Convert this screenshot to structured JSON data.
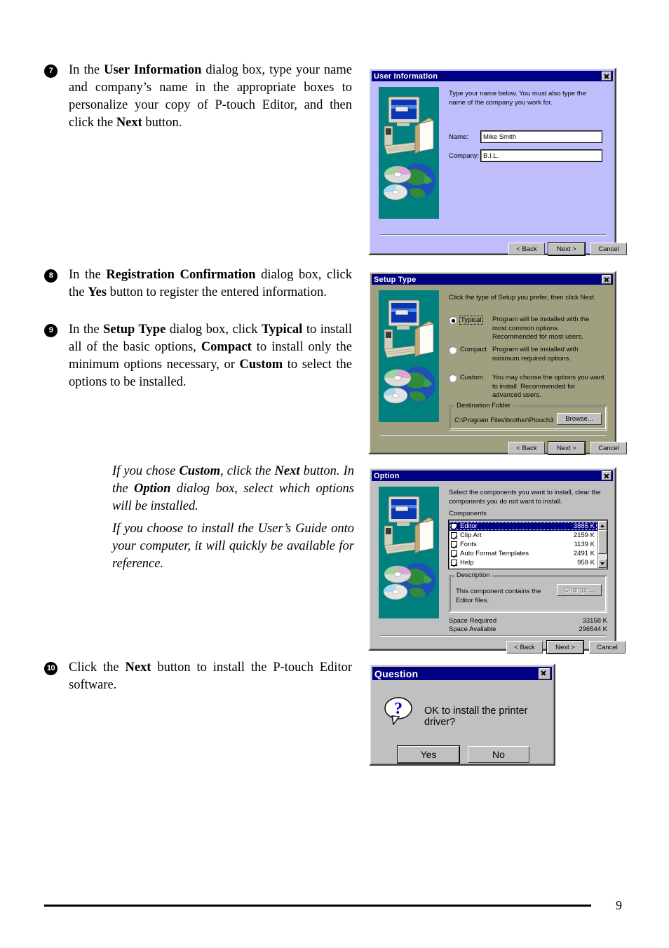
{
  "page": {
    "number": "9"
  },
  "steps": [
    {
      "marker": "7",
      "html": "In the <b>User Information</b> dialog box, type your name and company’s name in the appropriate boxes to personalize your copy of P-touch Editor, and then click the <b>Next</b> button."
    },
    {
      "marker": "8",
      "html": "In the <b>Registration Confirmation</b> dialog box, click the <b>Yes</b> button to register the entered information."
    },
    {
      "marker": "9",
      "html": "In the <b>Setup Type</b> dialog box, click <b>Typical</b> to install all of the basic options, <b>Compact</b> to install only the minimum options necessary, or <b>Custom</b> to select the options to be installed."
    },
    {
      "marker": "10",
      "html": "Click the <b>Next</b> button to install the P-touch Editor software."
    }
  ],
  "notes": [
    {
      "html": "If you chose <b>Custom</b>, click the <b>Next</b> button. In the <b>Option</b> dialog box, select which options will be installed."
    },
    {
      "html": "If you choose to install the User’s Guide onto your computer, it will quickly be available for reference."
    }
  ],
  "dialogs": {
    "user_information": {
      "title": "User Information",
      "close_icon": "close-icon",
      "instruction": "Type your name below. You must also type the name of the company you work for.",
      "fields": [
        {
          "label": "Name:",
          "label_accel": "a",
          "value": "Mike Smith"
        },
        {
          "label": "Company:",
          "label_accel": "C",
          "value": "B.I.L."
        }
      ],
      "buttons": [
        {
          "label": "< Back",
          "accel": "B",
          "state": "normal"
        },
        {
          "label": "Next >",
          "accel": "N",
          "state": "default"
        },
        {
          "label": "Cancel",
          "accel": "",
          "state": "normal"
        }
      ],
      "background": "#bfbdfb",
      "titlebar_color": "#000080"
    },
    "setup_type": {
      "title": "Setup Type",
      "close_icon": "close-icon",
      "instruction": "Click the type of Setup you prefer, then click Next.",
      "options": [
        {
          "label": "Typical",
          "selected": true,
          "description": "Program will be installed with the most common options. Recommended for most users."
        },
        {
          "label": "Compact",
          "selected": false,
          "description": "Program will be installed with minimum required options."
        },
        {
          "label": "Custom",
          "selected": false,
          "description": "You may choose the options you want to install. Recommended for advanced users."
        }
      ],
      "destination": {
        "group_title": "Destination Folder",
        "path": "C:\\Program Files\\brother\\Ptouch3",
        "browse_label": "Browse..."
      },
      "buttons": [
        {
          "label": "< Back",
          "accel": "B",
          "state": "normal"
        },
        {
          "label": "Next >",
          "accel": "N",
          "state": "default"
        },
        {
          "label": "Cancel",
          "accel": "",
          "state": "normal"
        }
      ],
      "background": "#a0a080",
      "titlebar_color": "#000080"
    },
    "option": {
      "title": "Option",
      "close_icon": "close-icon",
      "instruction": "Select the components you want to install, clear the components you do not want to install.",
      "components_label": "Components",
      "components": [
        {
          "name": "Editor",
          "size": "3885 K",
          "checked": true,
          "selected": true
        },
        {
          "name": "Clip Art",
          "size": "2159 K",
          "checked": true,
          "selected": false
        },
        {
          "name": "Fonts",
          "size": "1139 K",
          "checked": true,
          "selected": false
        },
        {
          "name": "Auto Format Templates",
          "size": "2491 K",
          "checked": true,
          "selected": false
        },
        {
          "name": "Help",
          "size": "959 K",
          "checked": true,
          "selected": false
        }
      ],
      "description": {
        "group_title": "Description",
        "text": "This component contains the Editor files.",
        "change_label": "Change ..."
      },
      "space": [
        {
          "label": "Space Required",
          "value": "33158 K"
        },
        {
          "label": "Space Available",
          "value": "296544 K"
        }
      ],
      "buttons": [
        {
          "label": "< Back",
          "accel": "B",
          "state": "normal"
        },
        {
          "label": "Next >",
          "accel": "N",
          "state": "default"
        },
        {
          "label": "Cancel",
          "accel": "",
          "state": "normal"
        }
      ],
      "background": "#c0c0c0",
      "titlebar_color": "#000080"
    },
    "question": {
      "title": "Question",
      "close_icon": "close-icon",
      "icon": "question-mark-icon",
      "message": "OK to install the printer driver?",
      "buttons": [
        {
          "label": "Yes",
          "accel": "Y",
          "state": "default"
        },
        {
          "label": "No",
          "accel": "N",
          "state": "normal"
        }
      ],
      "background": "#c0c0c0",
      "titlebar_color": "#000080"
    }
  }
}
